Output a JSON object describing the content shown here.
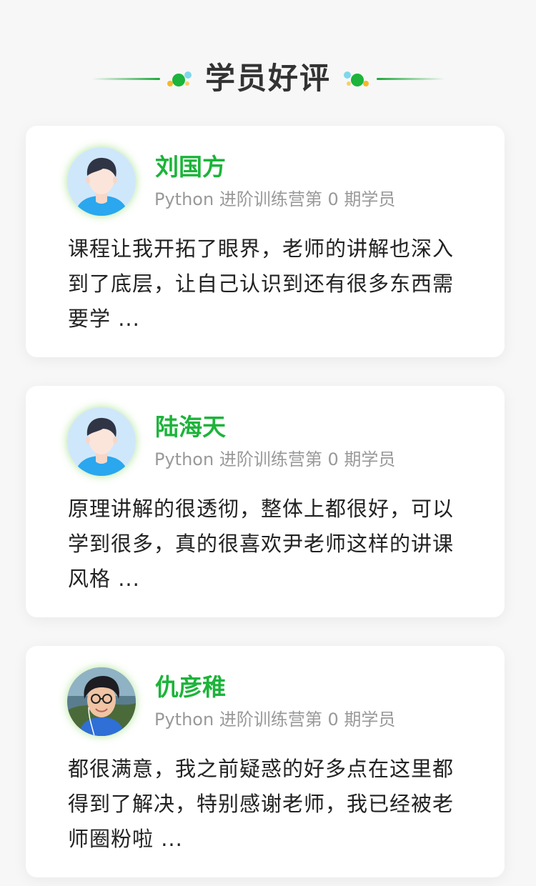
{
  "header": {
    "title": "学员好评"
  },
  "colors": {
    "accent_green": "#1cb43a",
    "line_green": "#1ea83c",
    "text_dark": "#222222",
    "text_muted": "#999999",
    "card_bg": "#ffffff",
    "page_bg": "#f7f7f7"
  },
  "reviews": [
    {
      "avatar": "cartoon-avatar-icon",
      "name": "刘国方",
      "role": "Python 进阶训练营第 0 期学员",
      "text": "课程让我开拓了眼界，老师的讲解也深入到了底层，让自己认识到还有很多东西需要学 ..."
    },
    {
      "avatar": "cartoon-avatar-icon",
      "name": "陆海天",
      "role": "Python 进阶训练营第 0 期学员",
      "text": "原理讲解的很透彻，整体上都很好，可以学到很多，真的很喜欢尹老师这样的讲课风格 ..."
    },
    {
      "avatar": "photo-avatar",
      "name": "仇彦稚",
      "role": "Python 进阶训练营第 0 期学员",
      "text": "都很满意，我之前疑惑的好多点在这里都得到了解决，特别感谢老师，我已经被老师圈粉啦 ..."
    }
  ]
}
